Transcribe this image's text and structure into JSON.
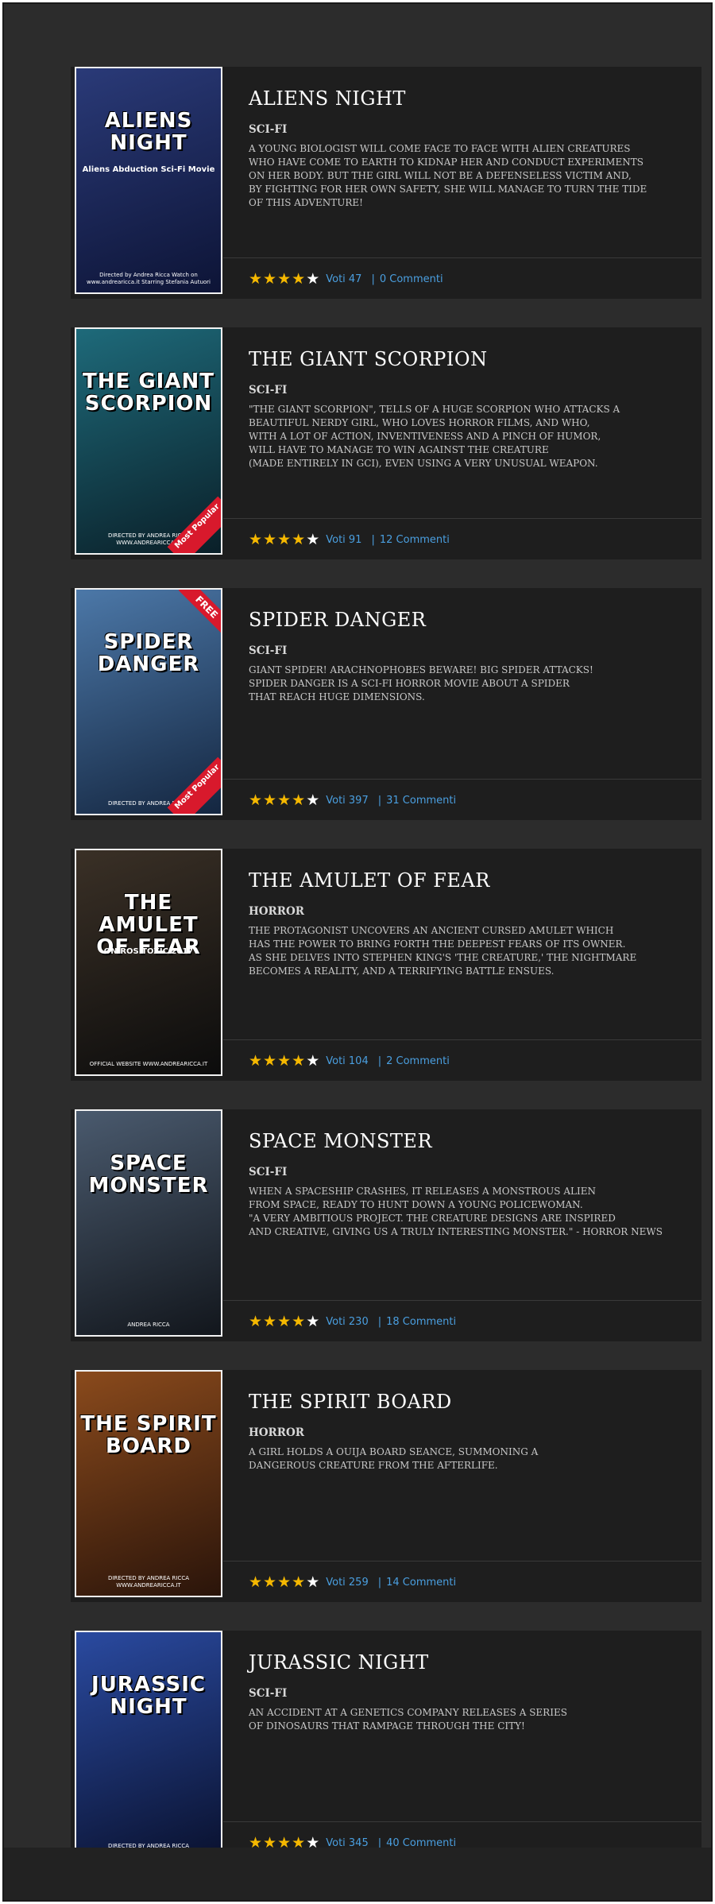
{
  "movies": [
    {
      "title": "ALIENS NIGHT",
      "genre": "SCI-FI",
      "description": "A YOUNG BIOLOGIST WILL COME FACE TO FACE WITH ALIEN CREATURES\nWHO HAVE COME TO EARTH TO KIDNAP HER AND CONDUCT EXPERIMENTS\nON HER BODY.  BUT THE GIRL WILL NOT BE A DEFENSELESS VICTIM AND,\nBY FIGHTING FOR HER OWN SAFETY, SHE WILL MANAGE TO TURN THE TIDE\nOF THIS ADVENTURE!",
      "rating": 4,
      "votes": "Voti 47",
      "comments": "0 Commenti",
      "poster": {
        "title": "ALIENS NIGHT",
        "subtitle": "Aliens Abduction Sci-Fi Movie",
        "credits": "Directed by  Andrea Ricca   Watch on  www.andrearicca.it   Starring  Stefania Autuori",
        "badge": "",
        "free": "",
        "colors": [
          "#2a3a78",
          "#0d1436"
        ]
      }
    },
    {
      "title": "THE GIANT SCORPION",
      "genre": "SCI-FI",
      "description": "\"THE  GIANT SCORPION\", TELLS OF A HUGE SCORPION WHO ATTACKS A\nBEAUTIFUL NERDY  GIRL, WHO LOVES HORROR FILMS, AND WHO,\nWITH A LOT OF ACTION,  INVENTIVENESS AND A PINCH OF HUMOR,\nWILL HAVE TO MANAGE TO WIN AGAINST  THE CREATURE\n(MADE ENTIRELY IN GCI), EVEN USING A VERY UNUSUAL WEAPON.",
      "rating": 4,
      "votes": "Voti 91",
      "comments": "12 Commenti",
      "poster": {
        "title": "THE GIANT SCORPION",
        "subtitle": "",
        "credits": "DIRECTED BY  ANDREA RICCA   WWW.ANDREARICCA.IT",
        "badge": "Most Popular",
        "free": "",
        "colors": [
          "#1e6a7a",
          "#0a1f28"
        ]
      }
    },
    {
      "title": "SPIDER DANGER",
      "genre": "SCI-FI",
      "description": "GIANT  SPIDER! ARACHNOPHOBES BEWARE! BIG SPIDER ATTACKS!\nSPIDER DANGER IS A  SCI-FI HORROR MOVIE ABOUT A SPIDER\nTHAT REACH HUGE DIMENSIONS.",
      "rating": 4,
      "votes": "Voti 397",
      "comments": "31 Commenti",
      "poster": {
        "title": "SPIDER DANGER",
        "subtitle": "",
        "credits": "DIRECTED BY  ANDREA RICCA",
        "badge": "Most Popular",
        "free": "FREE",
        "colors": [
          "#4c78a8",
          "#142640"
        ]
      }
    },
    {
      "title": "THE AMULET OF FEAR",
      "genre": "HORROR",
      "description": "THE PROTAGONIST UNCOVERS AN ANCIENT CURSED AMULET  WHICH\nHAS THE POWER TO BRING FORTH THE DEEPEST FEARS OF ITS OWNER.\nAS  SHE DELVES INTO STEPHEN KING'S 'THE CREATURE,' THE NIGHTMARE\nBECOMES A  REALITY, AND A TERRIFYING BATTLE ENSUES.",
      "rating": 4,
      "votes": "Voti 104",
      "comments": "2 Commenti",
      "poster": {
        "title": "THE AMULET OF FEAR",
        "subtitle": "ONIROS  TOXIC 2017",
        "credits": "OFFICIAL WEBSITE  WWW.ANDREARICCA.IT",
        "badge": "",
        "free": "",
        "colors": [
          "#3a3026",
          "#0c0c0c"
        ]
      }
    },
    {
      "title": "SPACE MONSTER",
      "genre": "SCI-FI",
      "description": "WHEN A SPACESHIP CRASHES, IT RELEASES A MONSTROUS ALIEN\nFROM SPACE, READY TO  HUNT DOWN A YOUNG POLICEWOMAN.\n\"A VERY AMBITIOUS PROJECT. THE CREATURE  DESIGNS ARE INSPIRED\nAND CREATIVE, GIVING US A TRULY INTERESTING  MONSTER.\" - HORROR NEWS",
      "rating": 4,
      "votes": "Voti 230",
      "comments": "18 Commenti",
      "poster": {
        "title": "SPACE MONSTER",
        "subtitle": "",
        "credits": "ANDREA RICCA",
        "badge": "",
        "free": "",
        "colors": [
          "#4a5a6e",
          "#12161c"
        ]
      }
    },
    {
      "title": "THE SPIRIT BOARD",
      "genre": "HORROR",
      "description": "A GIRL HOLDS A OUIJA BOARD SEANCE, SUMMONING A\nDANGEROUS CREATURE FROM THE AFTERLIFE.",
      "rating": 4,
      "votes": "Voti 259",
      "comments": "14 Commenti",
      "poster": {
        "title": "THE SPIRIT BOARD",
        "subtitle": "",
        "credits": "DIRECTED BY  ANDREA RICCA   WWW.ANDREARICCA.IT",
        "badge": "",
        "free": "",
        "colors": [
          "#8a4a1c",
          "#2a140a"
        ]
      }
    },
    {
      "title": "JURASSIC NIGHT",
      "genre": "SCI-FI",
      "description": "AN ACCIDENT AT A GENETICS COMPANY RELEASES A SERIES\nOF DINOSAURS THAT RAMPAGE THROUGH THE CITY!",
      "rating": 4,
      "votes": "Voti 345",
      "comments": "40 Commenti",
      "poster": {
        "title": "JURASSIC NIGHT",
        "subtitle": "",
        "credits": "DIRECTED BY  ANDREA RICCA",
        "badge": "",
        "free": "",
        "colors": [
          "#2a4aa0",
          "#0a1230"
        ]
      }
    }
  ],
  "icons": {
    "star_full": "★",
    "star_empty": "★",
    "separator": "|"
  }
}
